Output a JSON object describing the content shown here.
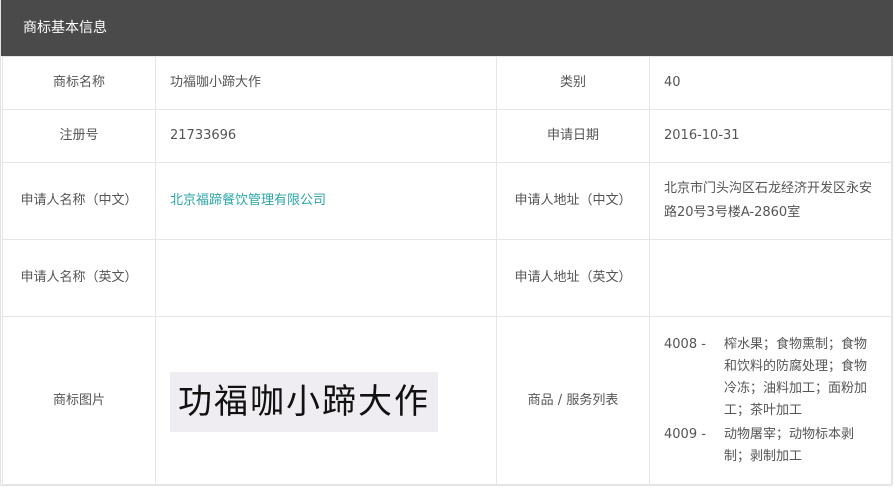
{
  "header": {
    "title": "商标基本信息"
  },
  "rows": {
    "name": {
      "label": "商标名称",
      "value": "功福咖小蹄大作",
      "label2": "类别",
      "value2": "40"
    },
    "reg": {
      "label": "注册号",
      "value": "21733696",
      "label2": "申请日期",
      "value2": "2016-10-31"
    },
    "applicant_cn": {
      "label": "申请人名称（中文）",
      "value": "北京福蹄餐饮管理有限公司",
      "label2": "申请人地址（中文）",
      "value2": "北京市门头沟区石龙经济开发区永安路20号3号楼A-2860室"
    },
    "applicant_en": {
      "label": "申请人名称（英文）",
      "value": "",
      "label2": "申请人地址（英文）",
      "value2": ""
    },
    "image": {
      "label": "商标图片",
      "image_text": "功福咖小蹄大作",
      "label2": "商品 / 服务列表"
    }
  },
  "goods": [
    {
      "code": "4008 -",
      "items": "榨水果；食物熏制；食物和饮料的防腐处理；食物冷冻；油料加工；面粉加工；茶叶加工"
    },
    {
      "code": "4009 -",
      "items": "动物屠宰；动物标本剥制；剥制加工"
    }
  ],
  "colors": {
    "header_bg": "#4a4a4a",
    "link": "#2aa6a8",
    "border": "#e6e6e6"
  }
}
